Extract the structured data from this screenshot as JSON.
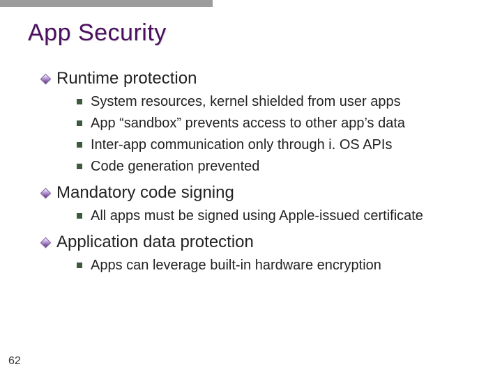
{
  "title": "App Security",
  "sections": [
    {
      "heading": "Runtime protection",
      "items": [
        "System resources, kernel shielded from user apps",
        "App “sandbox” prevents access to other app’s data",
        "Inter-app communication only through i. OS APIs",
        "Code generation prevented"
      ]
    },
    {
      "heading": "Mandatory code signing",
      "items": [
        "All apps must be signed using Apple-issued certificate"
      ]
    },
    {
      "heading": "Application data protection",
      "items": [
        "Apps can leverage built-in hardware encryption"
      ]
    }
  ],
  "page_number": "62"
}
